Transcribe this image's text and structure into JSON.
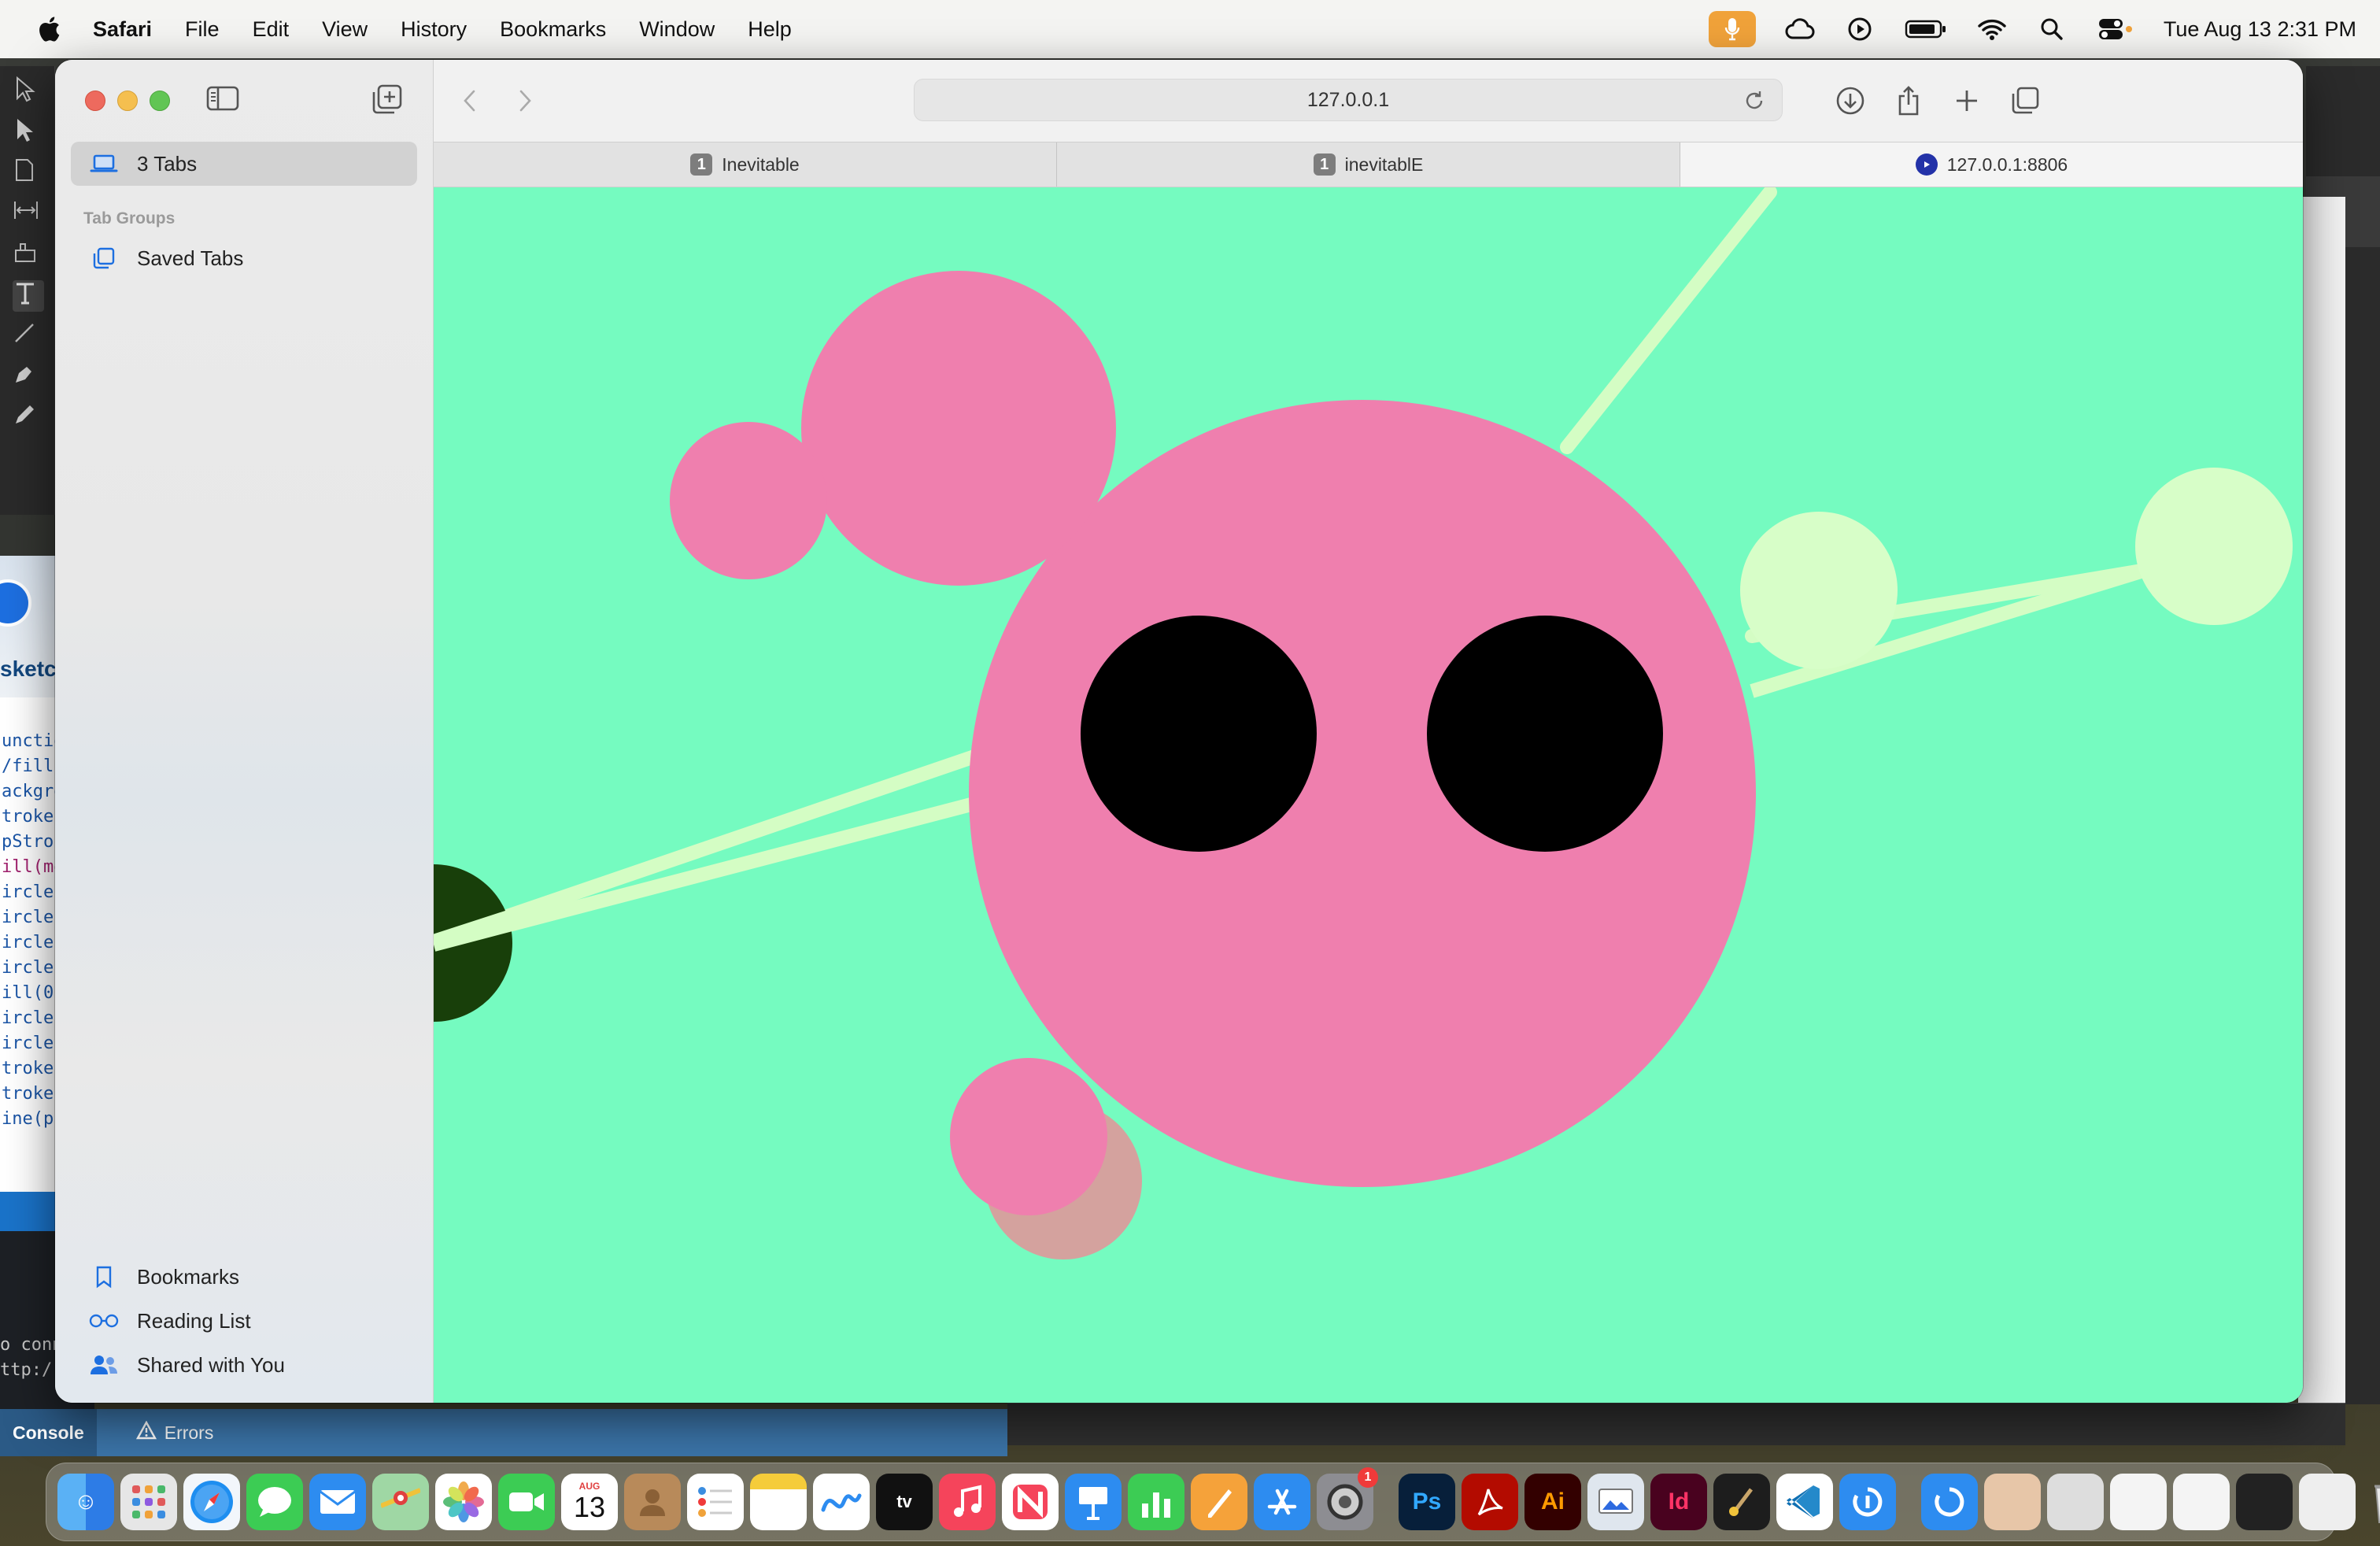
{
  "menubar": {
    "app_name": "Safari",
    "menus": [
      "File",
      "Edit",
      "View",
      "History",
      "Bookmarks",
      "Window",
      "Help"
    ],
    "clock": "Tue Aug 13  2:31 PM"
  },
  "safari": {
    "sidebar": {
      "current_tabs_label": "3 Tabs",
      "tab_groups_heading": "Tab Groups",
      "saved_tabs_label": "Saved Tabs",
      "bookmarks_label": "Bookmarks",
      "reading_list_label": "Reading List",
      "shared_label": "Shared with You"
    },
    "address": "127.0.0.1",
    "tabs": [
      {
        "badge": "1",
        "title": "Inevitable"
      },
      {
        "badge": "1",
        "title": "inevitablE"
      },
      {
        "title": "127.0.0.1:8806"
      }
    ]
  },
  "canvas": {
    "background": "#75fbc0",
    "colors": {
      "body": "#ef7fae",
      "eye": "#000000",
      "line": "#d4fdc4",
      "node": "#d7fec8",
      "dark_ball": "#183f0a",
      "shadow_ball": "#d4a29e"
    }
  },
  "background_editor": {
    "sketch_title": "sketch",
    "code_lines": [
      "unctio",
      "/fill",
      "ackgro",
      "troke",
      "pStrok",
      "ill(mo",
      "ircle",
      "ircle",
      "ircle",
      "ircle",
      "ill(0",
      "ircle",
      "ircle",
      "troke",
      "troke",
      "ine(p"
    ],
    "console_lines": [
      "o conn",
      "ttp:/"
    ],
    "console_tab": "Console",
    "errors_tab": "Errors"
  },
  "dock": {
    "calendar_month": "AUG",
    "calendar_day": "13",
    "settings_badge": "1",
    "apps": [
      "Finder",
      "Launchpad",
      "Safari",
      "Messages",
      "Mail",
      "Maps",
      "Photos",
      "FaceTime",
      "Calendar",
      "Contacts",
      "Reminders",
      "Notes",
      "Freeform",
      "TV",
      "Music",
      "News",
      "Keynote",
      "Numbers",
      "Pages",
      "App Store",
      "System Settings",
      "Photoshop",
      "Acrobat",
      "Illustrator",
      "Preview",
      "InDesign",
      "Processing",
      "VS Code",
      "Remote"
    ]
  }
}
